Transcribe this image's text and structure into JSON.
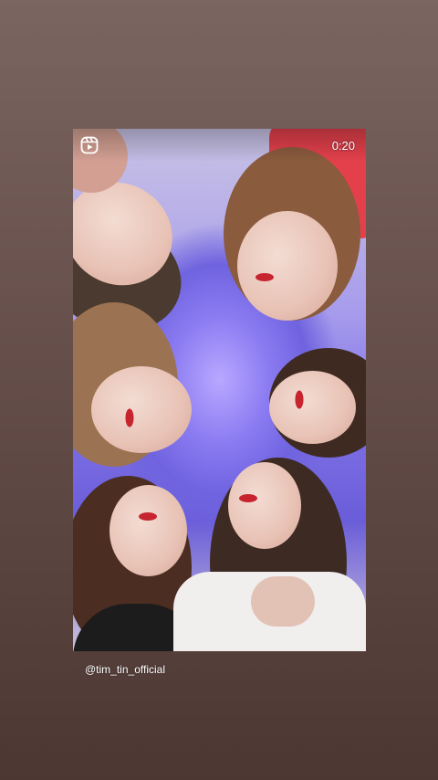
{
  "story": {
    "timer": "0:20",
    "username": "@tim_tin_official"
  },
  "icons": {
    "reels": "reels-icon"
  }
}
